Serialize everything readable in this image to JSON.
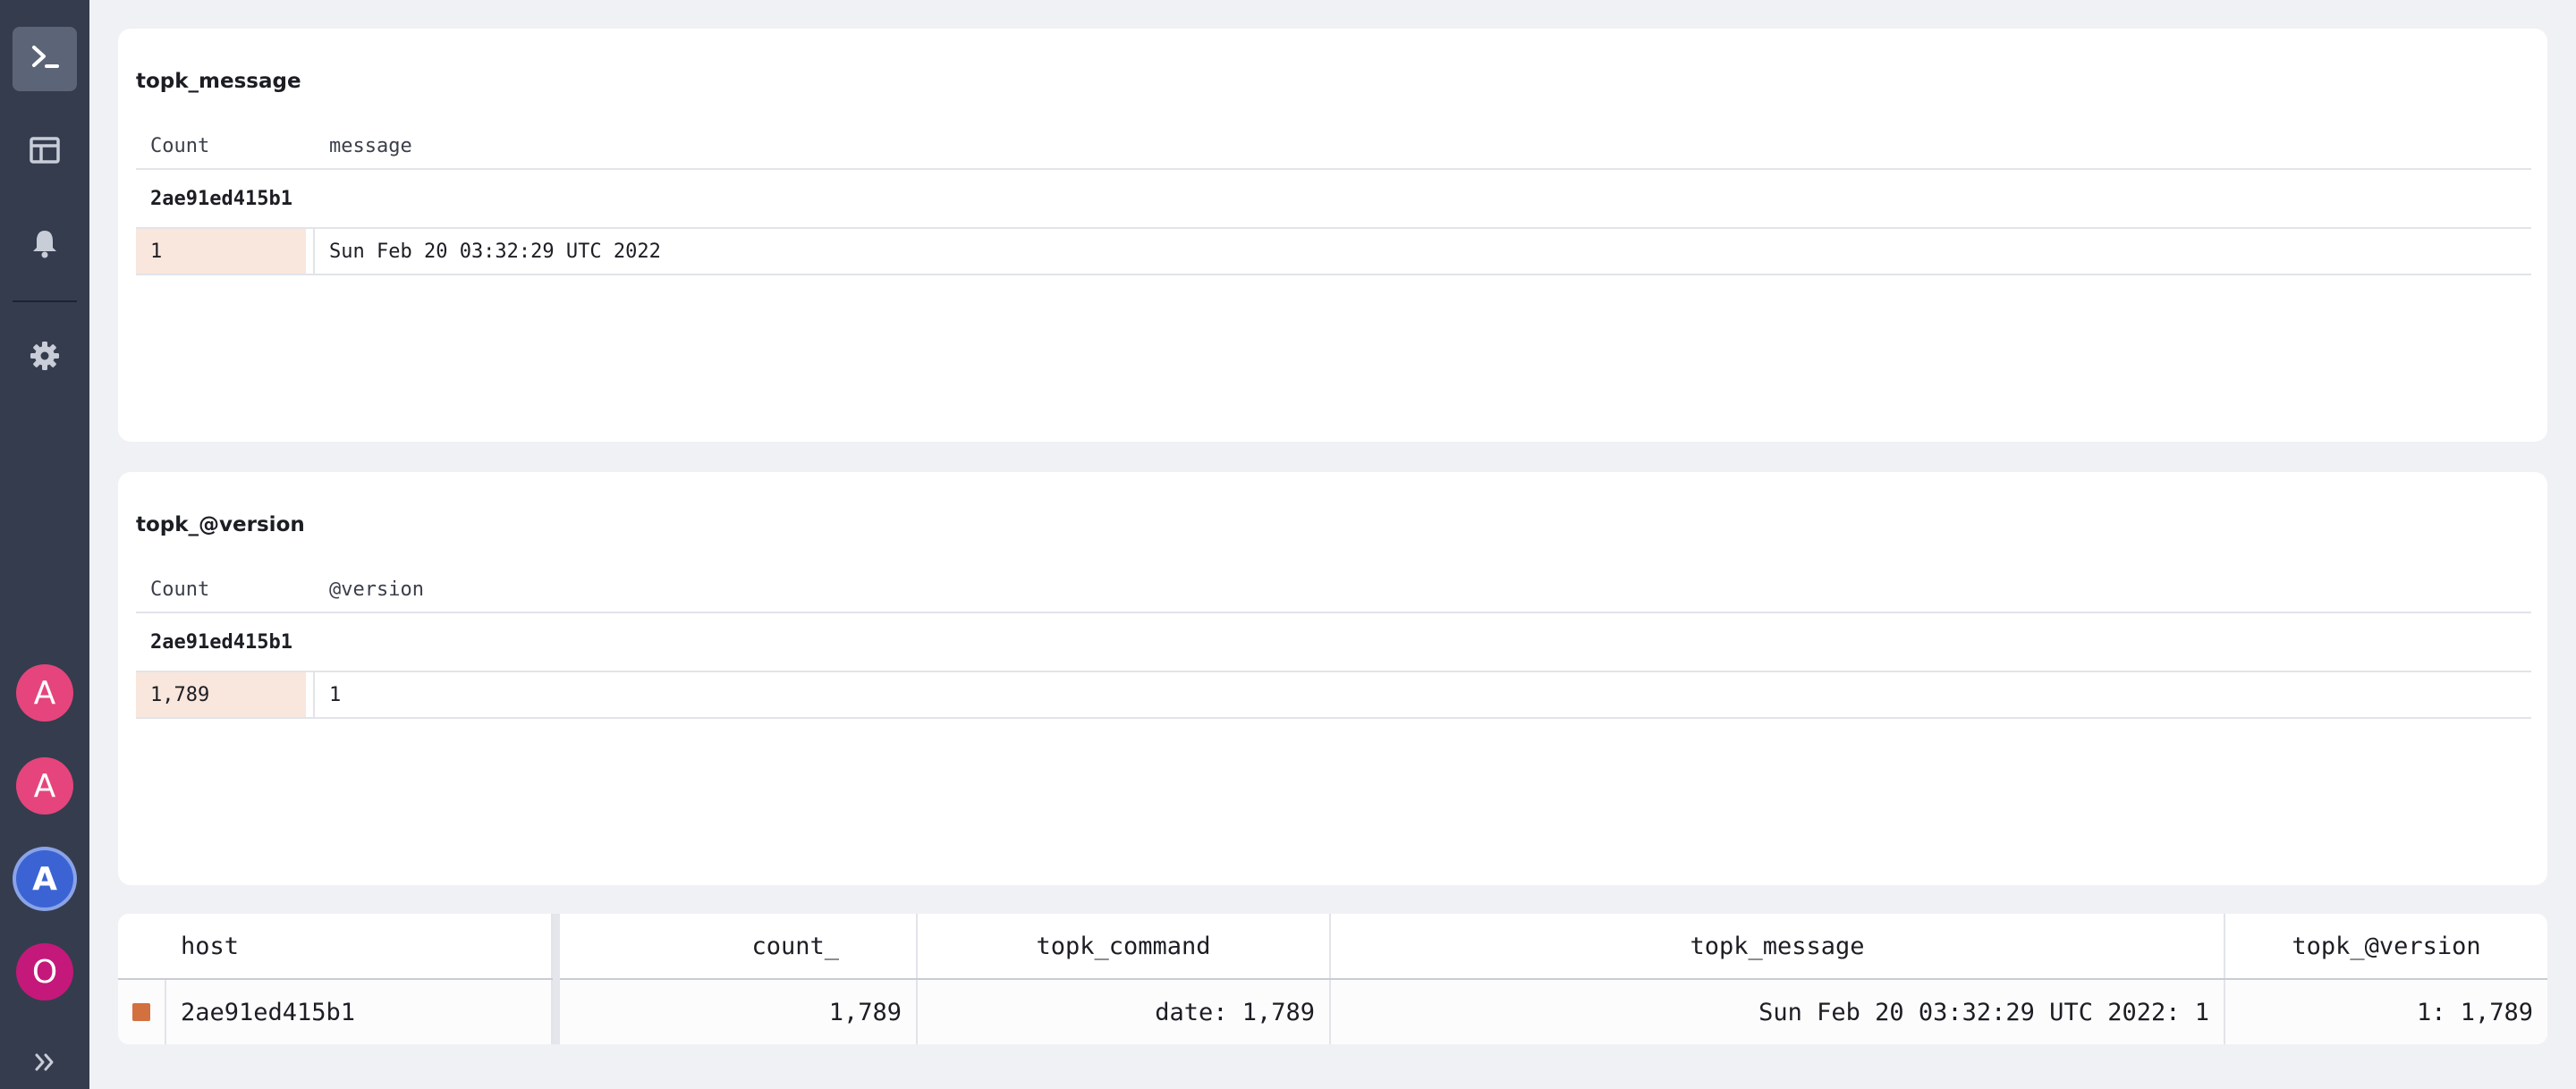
{
  "sidebar": {
    "items": [
      {
        "name": "terminal",
        "icon": "terminal-icon"
      },
      {
        "name": "dashboard",
        "icon": "layout-icon"
      },
      {
        "name": "alerts",
        "icon": "bell-icon"
      },
      {
        "name": "settings",
        "icon": "gear-icon"
      }
    ],
    "avatars": [
      "A",
      "A",
      "A",
      "O"
    ],
    "expand_icon": "double-chevron-right-icon"
  },
  "panels": [
    {
      "title": "topk_message",
      "col1": "Count",
      "col2": "message",
      "group": "2ae91ed415b1",
      "rows": [
        {
          "count": "1",
          "value": "Sun Feb 20 03:32:29 UTC 2022"
        }
      ]
    },
    {
      "title": "topk_@version",
      "col1": "Count",
      "col2": "@version",
      "group": "2ae91ed415b1",
      "rows": [
        {
          "count": "1,789",
          "value": "1"
        }
      ]
    }
  ],
  "results": {
    "headers": [
      "host",
      "count_",
      "topk_command",
      "topk_message",
      "topk_@version"
    ],
    "rows": [
      {
        "color": "#d3703f",
        "host": "2ae91ed415b1",
        "count_": "1,789",
        "topk_command": "date: 1,789",
        "topk_message": "Sun Feb 20 03:32:29 UTC 2022: 1",
        "topk_version": "1: 1,789"
      }
    ]
  },
  "colors": {
    "sidebar_bg": "#353c4e",
    "accent_orange": "#d3703f",
    "count_cell_bg": "#f9e6dc"
  }
}
